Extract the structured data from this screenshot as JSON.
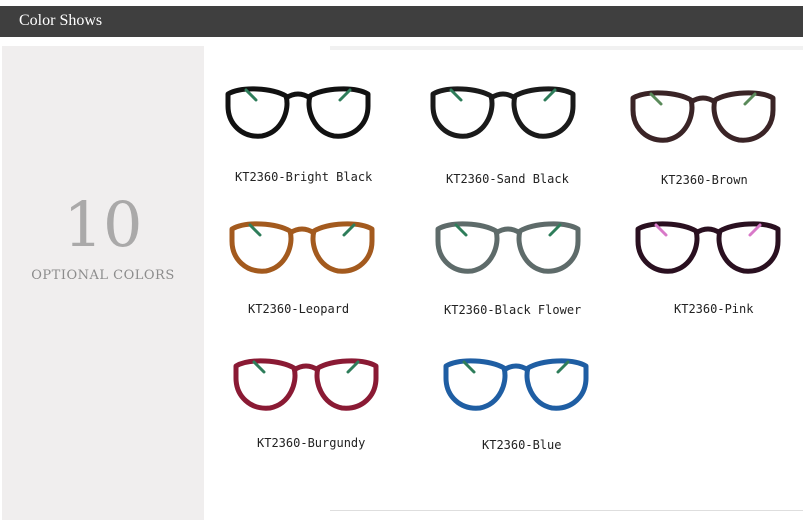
{
  "header": {
    "title": "Color Shows"
  },
  "side_panel": {
    "count": "10",
    "label": "OPTIONAL COLORS"
  },
  "frames": [
    {
      "label": "KT2360-Bright Black",
      "color": "#111111",
      "temple_color": "#2e7d5a"
    },
    {
      "label": "KT2360-Sand Black",
      "color": "#1a1a1a",
      "temple_color": "#2e7d5a"
    },
    {
      "label": "KT2360-Brown",
      "color": "#3a2426",
      "temple_color": "#5a8a5a"
    },
    {
      "label": "KT2360-Leopard",
      "color": "#a35a1e",
      "temple_color": "#2e7d5a"
    },
    {
      "label": "KT2360-Black Flower",
      "color": "#5e6b6a",
      "temple_color": "#2e7d5a"
    },
    {
      "label": "KT2360-Pink",
      "color": "#2a1020",
      "temple_color": "#d879c8"
    },
    {
      "label": "KT2360-Burgundy",
      "color": "#8a1a34",
      "temple_color": "#2e7d5a"
    },
    {
      "label": "KT2360-Blue",
      "color": "#1f5ea3",
      "temple_color": "#2e7d5a"
    }
  ]
}
